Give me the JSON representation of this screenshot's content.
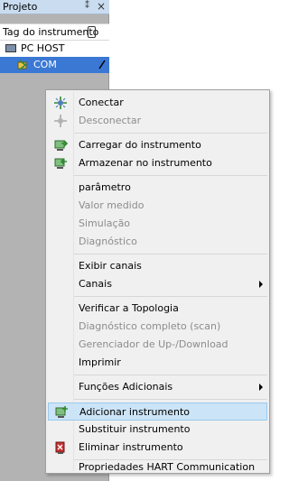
{
  "panel": {
    "title": "Projeto",
    "pin_glyph": "⁑",
    "close_glyph": "×",
    "column_header": "Tag do instrumento",
    "tree": {
      "host_label": "PC HOST",
      "com_label": "COM"
    }
  },
  "menu": {
    "conectar": "Conectar",
    "desconectar": "Desconectar",
    "carregar": "Carregar do instrumento",
    "armazenar": "Armazenar no instrumento",
    "parametro": "parâmetro",
    "valor_medido": "Valor medido",
    "simulacao": "Simulação",
    "diagnostico": "Diagnóstico",
    "exibir_canais": "Exibir canais",
    "canais": "Canais",
    "verificar_topologia": "Verificar a Topologia",
    "diagnostico_completo": "Diagnóstico completo (scan)",
    "gerenciador": "Gerenciador de Up-/Download",
    "imprimir": "Imprimir",
    "funcoes_adicionais": "Funções Adicionais",
    "adicionar_instrumento": "Adicionar instrumento",
    "substituir_instrumento": "Substituir instrumento",
    "eliminar_instrumento": "Eliminar instrumento",
    "propriedades": "Propriedades HART Communication"
  },
  "colors": {
    "panel_bg": "#b3b3b3",
    "selection": "#3a78d4",
    "menu_bg": "#f0f0f0",
    "menu_highlight": "#cce4f7",
    "disabled_text": "#8c8c8c"
  },
  "icons": {
    "connect": "connect-icon",
    "disconnect": "disconnect-icon",
    "upload": "upload-from-device-icon",
    "download": "download-to-device-icon",
    "add_device": "add-device-icon",
    "delete_device": "delete-device-icon"
  }
}
